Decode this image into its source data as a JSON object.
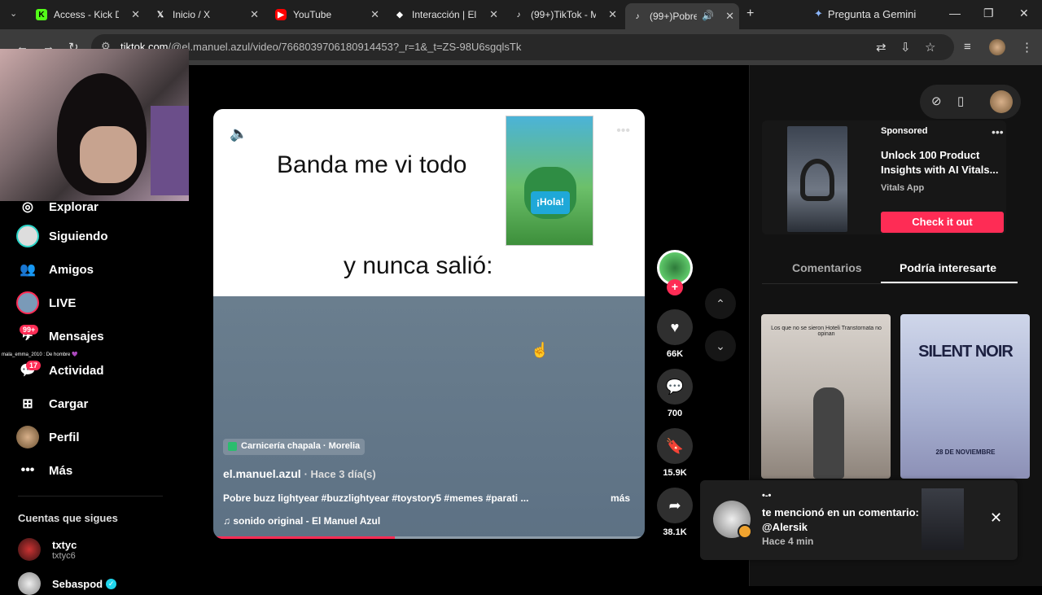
{
  "browser": {
    "tabs": [
      {
        "title": "Access - Kick Da",
        "favicon": "kick-icon"
      },
      {
        "title": "Inicio / X",
        "favicon": "x-icon"
      },
      {
        "title": "YouTube",
        "favicon": "youtube-icon"
      },
      {
        "title": "Interacción | El c",
        "favicon": "generic-icon"
      },
      {
        "title": "(99+)TikTok - M",
        "favicon": "tiktok-icon"
      },
      {
        "title": "(99+)Pobre",
        "favicon": "tiktok-icon"
      }
    ],
    "gemini_label": "Pregunta a Gemini",
    "url_host": "tiktok.com",
    "url_path": "/@el.manuel.azul/video/7668039706180914453?_r=1&_t=ZS-98U6sgqlsTk"
  },
  "sidebar": {
    "items": [
      {
        "label": "Explorar"
      },
      {
        "label": "Siguiendo"
      },
      {
        "label": "Amigos"
      },
      {
        "label": "LIVE"
      },
      {
        "label": "Mensajes",
        "badge": "99+"
      },
      {
        "label": "Actividad",
        "badge": "17"
      },
      {
        "label": "Cargar"
      },
      {
        "label": "Perfil"
      },
      {
        "label": "Más"
      }
    ],
    "chat_overlay": "mala_emma_2010 : De hombre 💜",
    "following_title": "Cuentas que sigues",
    "following": [
      {
        "name": "txtyc",
        "handle": "txtyc6"
      },
      {
        "name": "Sebaspod",
        "handle": ""
      }
    ]
  },
  "video": {
    "line1": "Banda me vi todo",
    "line2": "y nunca salió:",
    "poster_label": "¡Hola!",
    "location": "Carnicería chapala · Morelia",
    "author": "el.manuel.azul",
    "time_ago": "· Hace 3 día(s)",
    "description": "Pobre buzz lightyear #buzzlightyear #toystory5 #memes #parati ...",
    "more_label": "más",
    "sound": "♫  sonido original - El Manuel Azul",
    "progress_fraction": 0.42
  },
  "actions": {
    "likes": "66K",
    "comments": "700",
    "saves": "15.9K",
    "shares": "38.1K"
  },
  "right": {
    "ad": {
      "sponsored": "Sponsored",
      "title": "Unlock 100 Product Insights with AI Vitals...",
      "brand": "Vitals App",
      "cta": "Check it out"
    },
    "tabs": [
      "Comentarios",
      "Podría interesarte"
    ],
    "thumb1_caption": "Los que no se sieron Hoteli Transtornata no opinan",
    "thumb2_title": "SILENT NOIR",
    "thumb2_date": "28 DE NOVIEMBRE"
  },
  "notification": {
    "name": "•-•",
    "message": "te mencionó en un comentario: @Alersik",
    "time": "Hace 4 min"
  },
  "colors": {
    "accent": "#fe2c55",
    "background": "#000000",
    "panel": "#121212"
  }
}
